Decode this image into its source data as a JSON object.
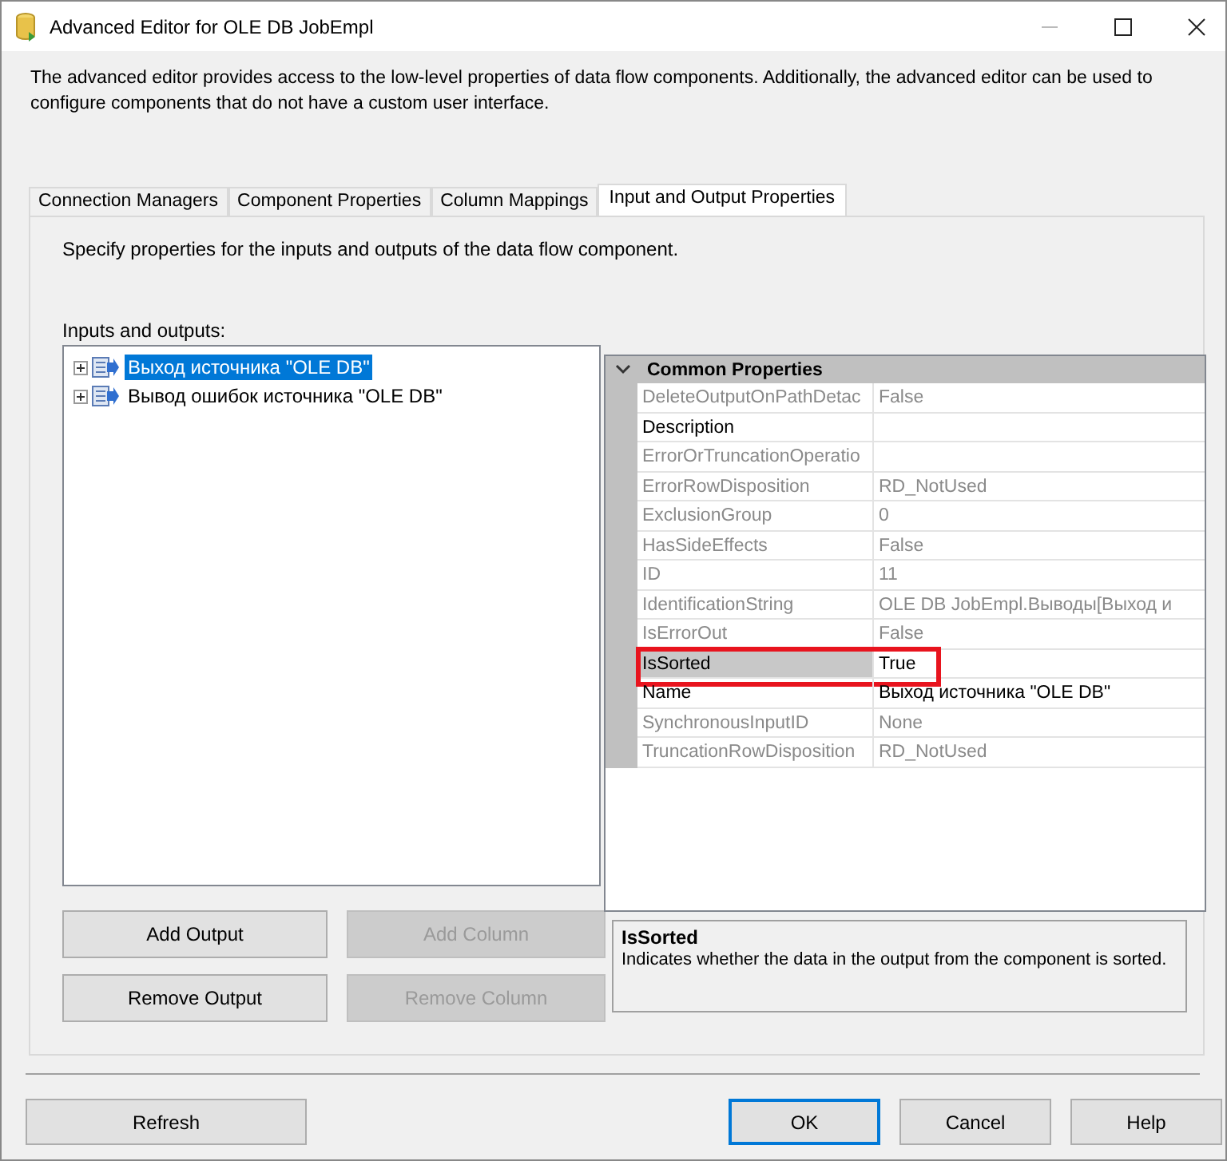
{
  "window": {
    "title": "Advanced Editor for OLE DB JobEmpl"
  },
  "description": "The advanced editor provides access to the low-level properties of data flow components. Additionally, the advanced editor can be used to configure components that do not have a custom user interface.",
  "tabs": [
    {
      "label": "Connection Managers",
      "selected": false
    },
    {
      "label": "Component Properties",
      "selected": false
    },
    {
      "label": "Column Mappings",
      "selected": false
    },
    {
      "label": "Input and Output Properties",
      "selected": true
    }
  ],
  "instruction": "Specify properties for the inputs and outputs of the data flow component.",
  "tree_label": "Inputs and outputs:",
  "tree": [
    {
      "label": "Выход источника \"OLE DB\"",
      "expanded": false,
      "selected": true
    },
    {
      "label": "Вывод ошибок источника \"OLE DB\"",
      "expanded": false,
      "selected": false
    }
  ],
  "properties": {
    "category": "Common Properties",
    "expanded": true,
    "rows": [
      {
        "name": "DeleteOutputOnPathDetac",
        "value": "False",
        "read_only": true,
        "selected": false,
        "highlighted": false
      },
      {
        "name": "Description",
        "value": "",
        "read_only": false,
        "selected": false,
        "highlighted": false
      },
      {
        "name": "ErrorOrTruncationOperatio",
        "value": "",
        "read_only": true,
        "selected": false,
        "highlighted": false
      },
      {
        "name": "ErrorRowDisposition",
        "value": "RD_NotUsed",
        "read_only": true,
        "selected": false,
        "highlighted": false
      },
      {
        "name": "ExclusionGroup",
        "value": "0",
        "read_only": true,
        "selected": false,
        "highlighted": false
      },
      {
        "name": "HasSideEffects",
        "value": "False",
        "read_only": true,
        "selected": false,
        "highlighted": false
      },
      {
        "name": "ID",
        "value": "11",
        "read_only": true,
        "selected": false,
        "highlighted": false
      },
      {
        "name": "IdentificationString",
        "value": "OLE DB JobEmpl.Выводы[Выход и",
        "read_only": true,
        "selected": false,
        "highlighted": false
      },
      {
        "name": "IsErrorOut",
        "value": "False",
        "read_only": true,
        "selected": false,
        "highlighted": false
      },
      {
        "name": "IsSorted",
        "value": "True",
        "read_only": false,
        "selected": true,
        "highlighted": true
      },
      {
        "name": "Name",
        "value": "Выход источника \"OLE DB\"",
        "read_only": false,
        "selected": false,
        "highlighted": false
      },
      {
        "name": "SynchronousInputID",
        "value": "None",
        "read_only": true,
        "selected": false,
        "highlighted": false
      },
      {
        "name": "TruncationRowDisposition",
        "value": "RD_NotUsed",
        "read_only": true,
        "selected": false,
        "highlighted": false
      }
    ]
  },
  "left_buttons": [
    {
      "label": "Add Output",
      "disabled": false
    },
    {
      "label": "Add Column",
      "disabled": true
    },
    {
      "label": "Remove Output",
      "disabled": false
    },
    {
      "label": "Remove Column",
      "disabled": true
    }
  ],
  "help": {
    "title": "IsSorted",
    "text": "Indicates whether the data in the output from the component is sorted."
  },
  "footer_buttons": [
    {
      "label": "Refresh",
      "kind": "left",
      "default": false
    },
    {
      "label": "OK",
      "kind": "right",
      "default": true
    },
    {
      "label": "Cancel",
      "kind": "right",
      "default": false
    },
    {
      "label": "Help",
      "kind": "right",
      "default": false
    }
  ]
}
